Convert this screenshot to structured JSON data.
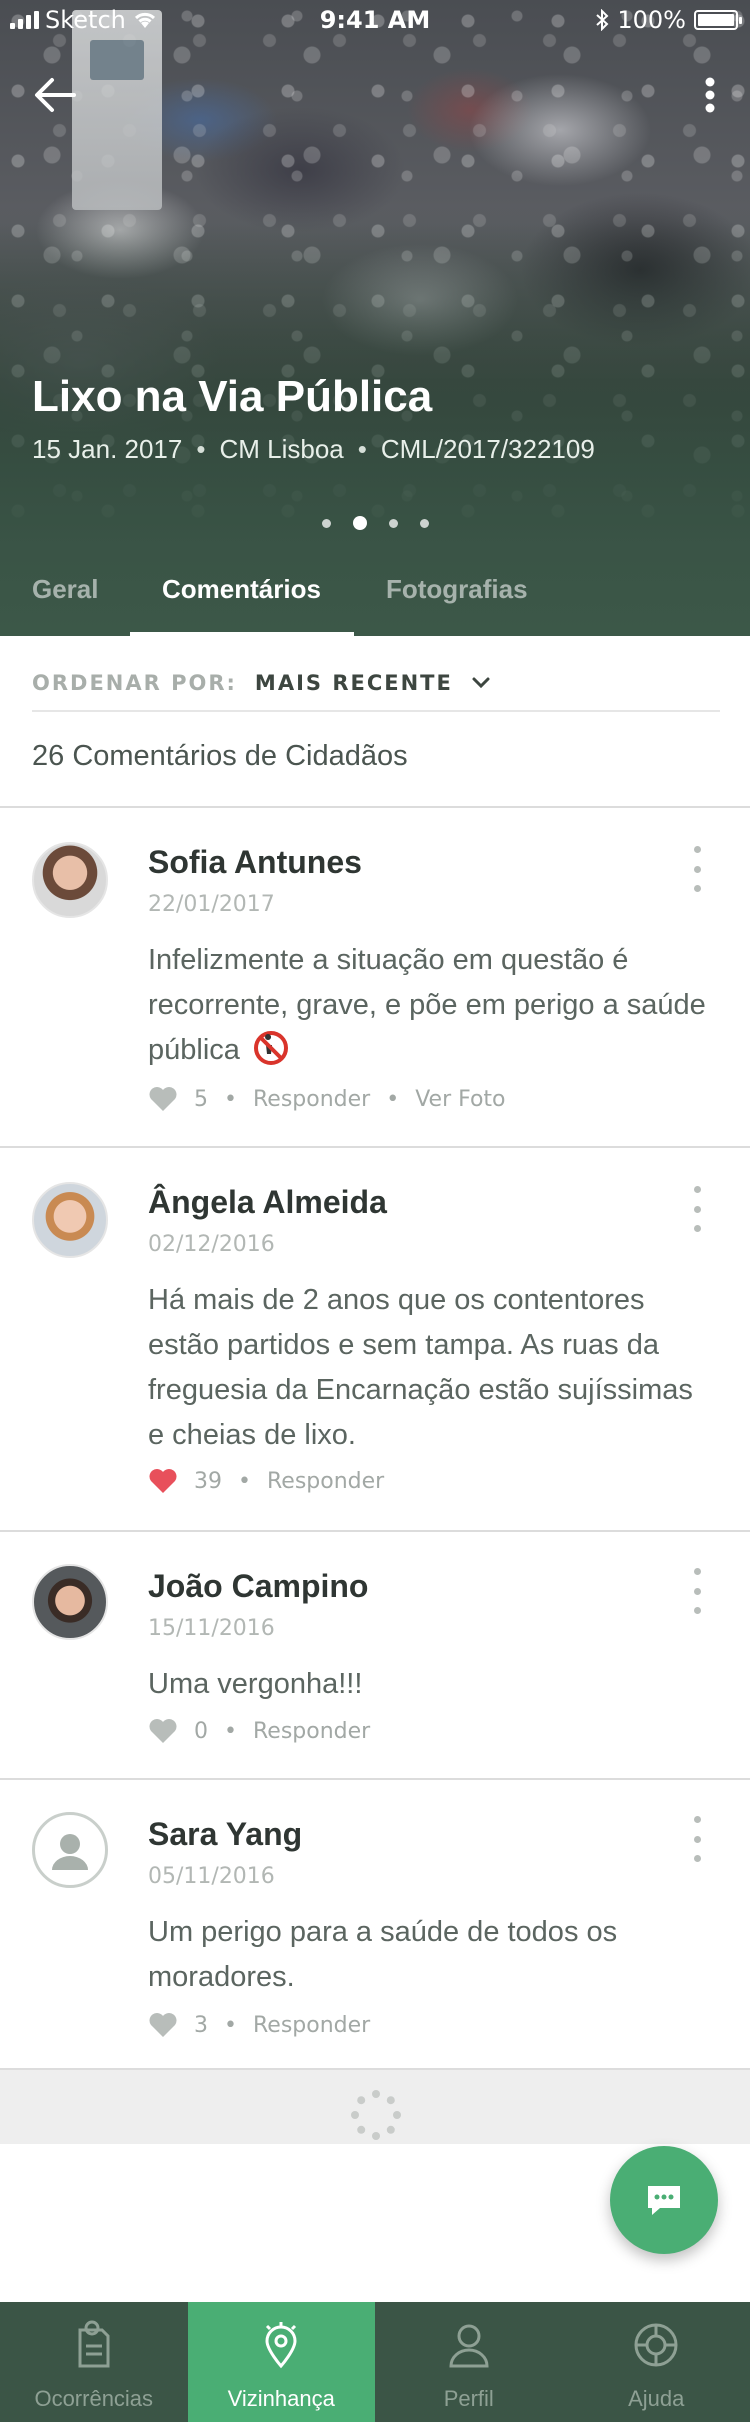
{
  "status_bar": {
    "carrier": "Sketch",
    "time": "9:41 AM",
    "battery": "100%"
  },
  "hero": {
    "title": "Lixo na Via Pública",
    "date": "15 Jan. 2017",
    "authority": "CM Lisboa",
    "reference": "CML/2017/322109",
    "meta_separator": "•",
    "pager": {
      "pages": 4,
      "active_index": 1
    }
  },
  "tabs": [
    {
      "label": "Geral",
      "active": false
    },
    {
      "label": "Comentários",
      "active": true
    },
    {
      "label": "Fotografias",
      "active": false
    }
  ],
  "sort": {
    "label": "ORDENAR POR:",
    "value": "MAIS RECENTE"
  },
  "comments_title": "26 Comentários de Cidadãos",
  "comments": [
    {
      "author": "Sofia Antunes",
      "date": "22/01/2017",
      "text": "Infelizmente a situação em questão é recorrente, grave, e põe em perigo a saúde pública",
      "likes": "5",
      "liked": false,
      "reply": "Responder",
      "extra_action": "Ver Foto"
    },
    {
      "author": "Ângela Almeida",
      "date": "02/12/2016",
      "text": "Há mais de 2 anos que os contentores estão partidos e sem tampa. As ruas da freguesia da Encarnação estão sujíssimas e cheias de lixo.",
      "likes": "39",
      "liked": true,
      "reply": "Responder"
    },
    {
      "author": "João Campino",
      "date": "15/11/2016",
      "text": "Uma vergonha!!!",
      "likes": "0",
      "liked": false,
      "reply": "Responder"
    },
    {
      "author": "Sara Yang",
      "date": "05/11/2016",
      "text": "Um perigo para a saúde de todos os moradores.",
      "likes": "3",
      "liked": false,
      "reply": "Responder"
    }
  ],
  "action_separator": "•",
  "tab_bar": [
    {
      "label": "Ocorrências",
      "icon": "report-icon",
      "active": false
    },
    {
      "label": "Vizinhança",
      "icon": "location-pin-icon",
      "active": true
    },
    {
      "label": "Perfil",
      "icon": "person-icon",
      "active": false
    },
    {
      "label": "Ajuda",
      "icon": "lifebuoy-icon",
      "active": false
    }
  ],
  "colors": {
    "accent_green": "#4aae74",
    "dark_green": "#3b5546",
    "like_red": "#e8505b"
  }
}
